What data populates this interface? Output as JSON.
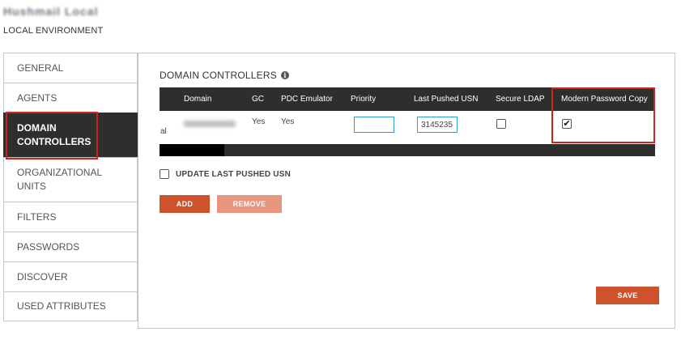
{
  "header": {
    "app_title": "Hushmail Local",
    "environment": "LOCAL ENVIRONMENT"
  },
  "sidebar": {
    "items": [
      {
        "label": "GENERAL"
      },
      {
        "label": "AGENTS"
      },
      {
        "label": "DOMAIN CONTROLLERS"
      },
      {
        "label": "ORGANIZATIONAL UNITS"
      },
      {
        "label": "FILTERS"
      },
      {
        "label": "PASSWORDS"
      },
      {
        "label": "DISCOVER"
      },
      {
        "label": "USED ATTRIBUTES"
      }
    ],
    "active": "DOMAIN CONTROLLERS"
  },
  "main": {
    "section_title": "DOMAIN CONTROLLERS",
    "info_icon": "info-icon",
    "table": {
      "columns": [
        "Domain",
        "GC",
        "PDC Emulator",
        "Priority",
        "Last Pushed USN",
        "Secure LDAP",
        "Modern Password Copy"
      ],
      "rows": [
        {
          "domain_suffix": "al",
          "gc": "Yes",
          "pdc_emulator": "Yes",
          "priority": "",
          "last_pushed_usn": "3145235",
          "secure_ldap": false,
          "modern_password_copy": true
        }
      ]
    },
    "update_last_pushed_usn": {
      "label": "UPDATE LAST PUSHED USN",
      "checked": false
    },
    "buttons": {
      "add": "ADD",
      "remove": "REMOVE",
      "save": "SAVE"
    },
    "checkmark": "✔"
  },
  "colors": {
    "accent": "#d0522c",
    "accent_disabled": "#e8957e",
    "header_dark": "#2e2e2e",
    "highlight": "#d32020",
    "input_border": "#2b9dc7"
  }
}
